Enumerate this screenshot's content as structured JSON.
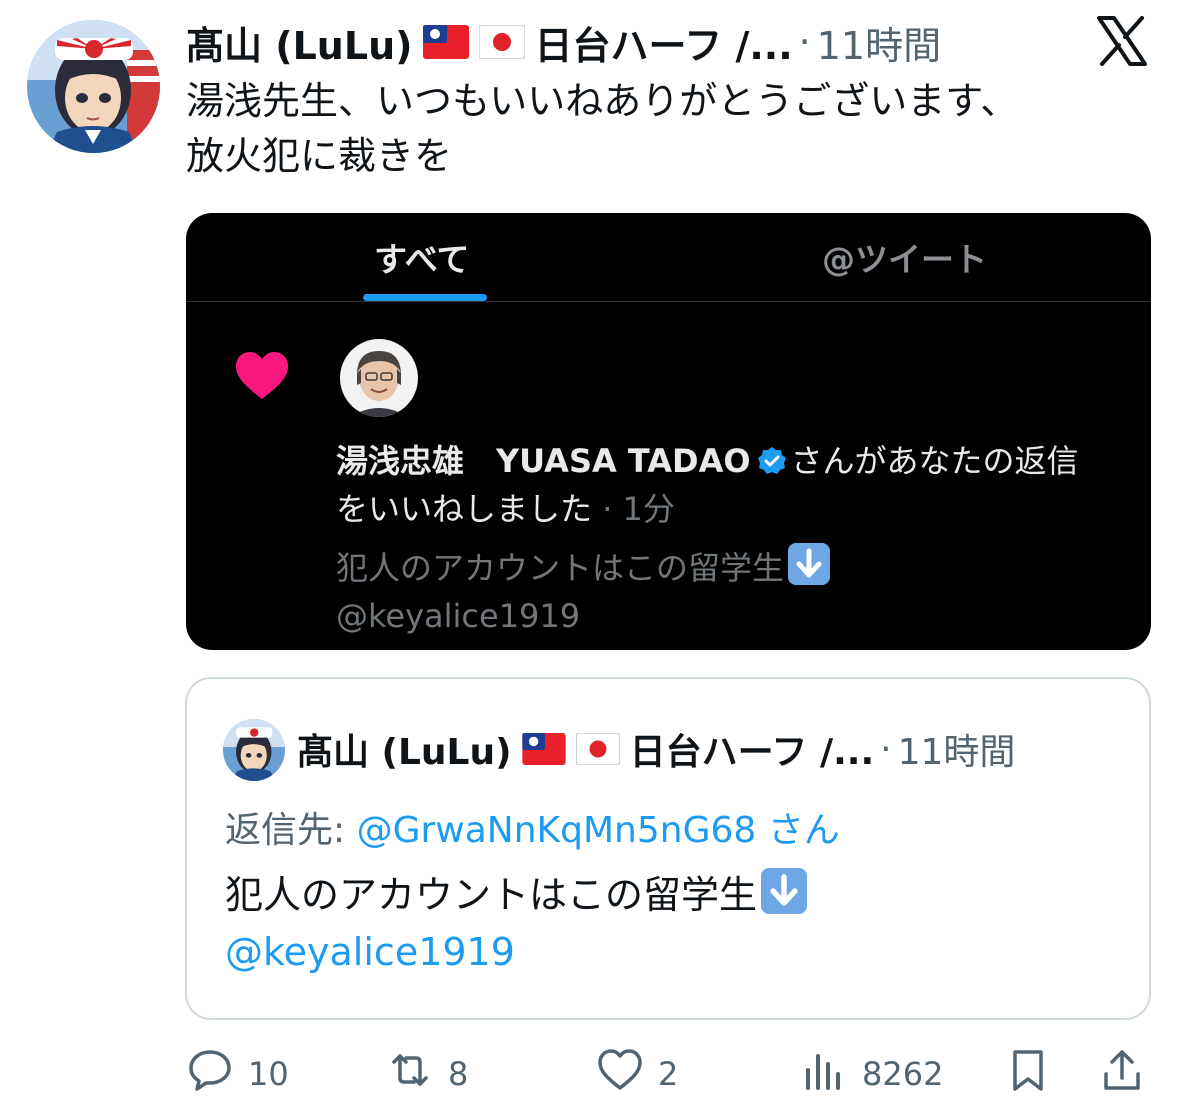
{
  "post": {
    "author": "髙山 (LuLu)",
    "flag1": "🇹🇼",
    "flag2": "🇯🇵",
    "header_suffix": "日台ハーフ /...",
    "separator": "·",
    "time": "11時間",
    "text_line1": "湯浅先生、いつもいいねありがとうございます、",
    "text_line2": "放火犯に裁きを"
  },
  "screenshot": {
    "tab_all": "すべて",
    "tab_tweets": "@ツイート",
    "notif_name": "湯浅忠雄　YUASA TADAO",
    "notif_action_a": "さんがあなたの返信",
    "notif_action_b": "をいいねしました",
    "notif_sep": " · ",
    "notif_time": "1分",
    "preview_line1": "犯人のアカウントはこの留学生",
    "preview_line2": "@keyalice1919"
  },
  "quote": {
    "author": "髙山 (LuLu)",
    "flag1": "🇹🇼",
    "flag2": "🇯🇵",
    "header_suffix": "日台ハーフ /...",
    "separator": "·",
    "time": "11時間",
    "reply_label": "返信先: ",
    "reply_handle": "@GrwaNnKqMn5nG68 さん",
    "body_line1": "犯人のアカウントはこの留学生",
    "body_line2": "@keyalice1919"
  },
  "actions": {
    "replies": "10",
    "retweets": "8",
    "likes": "2",
    "views": "8262"
  },
  "icons": {
    "x_logo": "x-logo-icon",
    "reply": "reply-icon",
    "retweet": "retweet-icon",
    "like": "heart-icon",
    "views": "views-icon",
    "bookmark": "bookmark-icon",
    "share": "share-icon"
  },
  "colors": {
    "link": "#1d9bf0",
    "muted": "#536471",
    "heart": "#f91880"
  }
}
